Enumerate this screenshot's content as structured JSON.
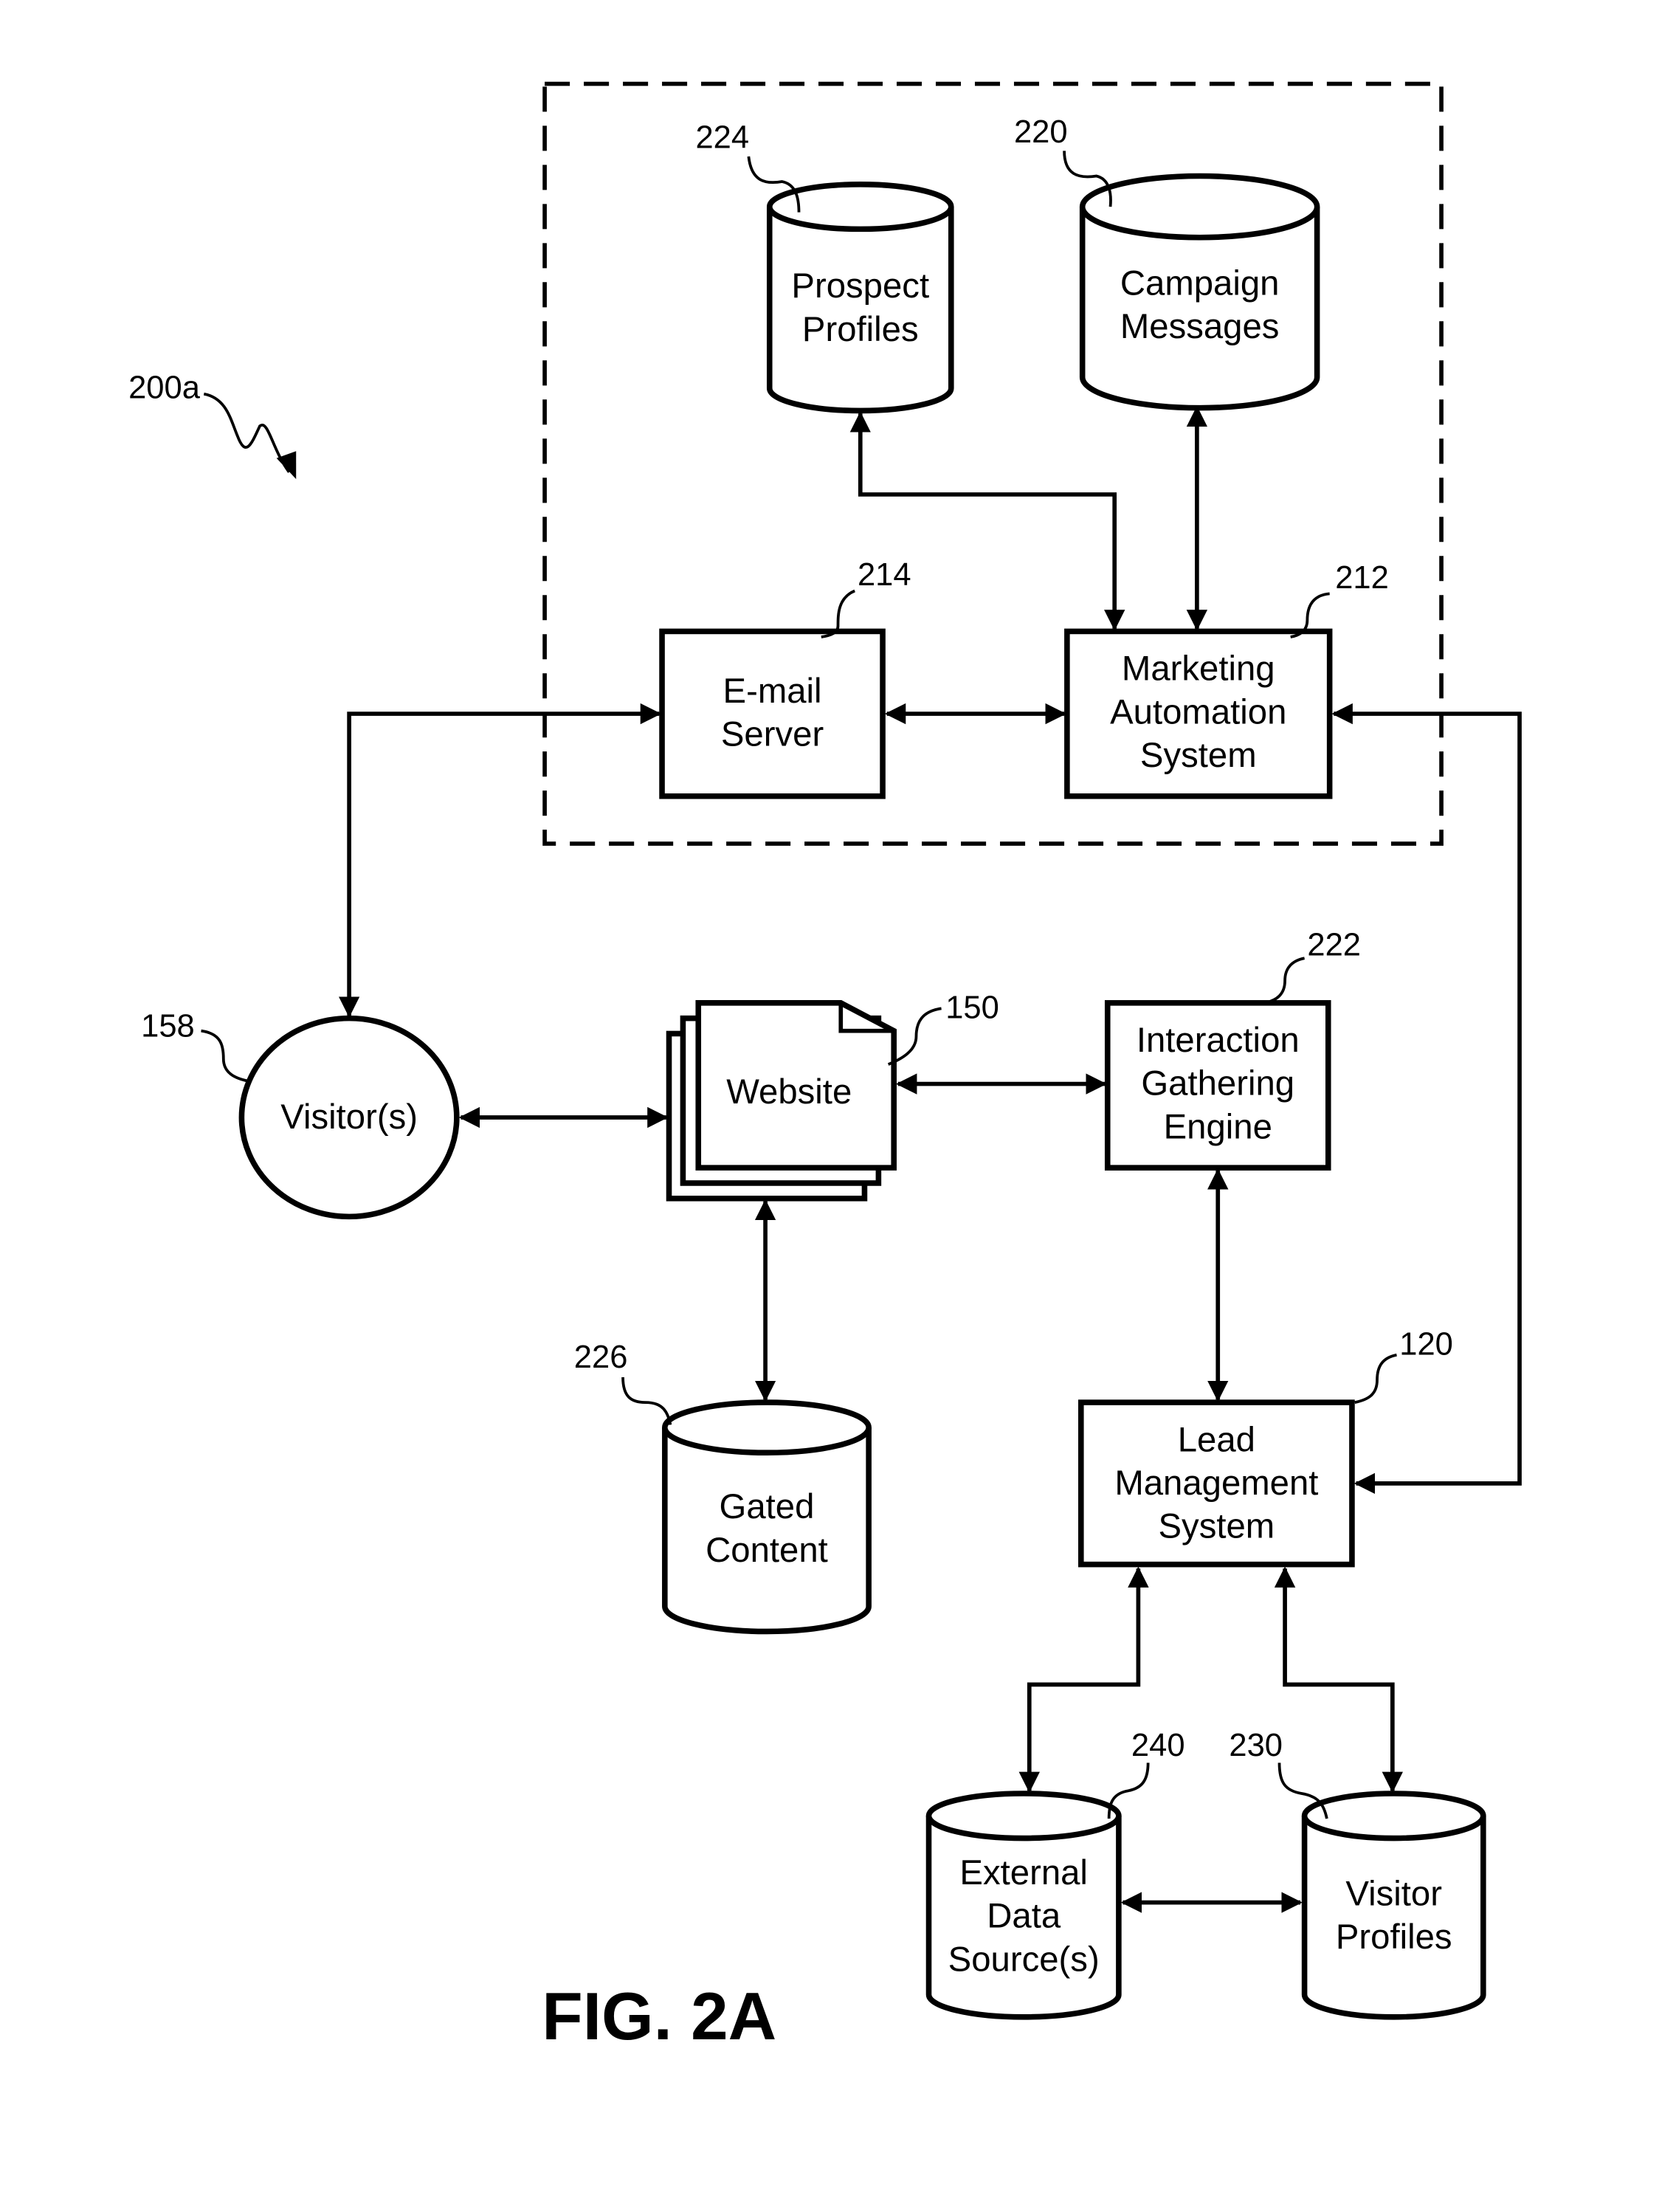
{
  "figure": {
    "title": "FIG. 2A",
    "reference": "200a"
  },
  "nodes": {
    "prospect_profiles": {
      "ref": "224",
      "lines": [
        "Prospect",
        "Profiles"
      ],
      "shape": "database"
    },
    "campaign_messages": {
      "ref": "220",
      "lines": [
        "Campaign",
        "Messages"
      ],
      "shape": "database"
    },
    "email_server": {
      "ref": "214",
      "lines": [
        "E-mail",
        "Server"
      ],
      "shape": "box"
    },
    "marketing_automation": {
      "ref": "212",
      "lines": [
        "Marketing",
        "Automation",
        "System"
      ],
      "shape": "box"
    },
    "visitors": {
      "ref": "158",
      "lines": [
        "Visitor(s)"
      ],
      "shape": "circle"
    },
    "website": {
      "ref": "150",
      "lines": [
        "Website"
      ],
      "shape": "document-stack"
    },
    "interaction_engine": {
      "ref": "222",
      "lines": [
        "Interaction",
        "Gathering",
        "Engine"
      ],
      "shape": "box"
    },
    "gated_content": {
      "ref": "226",
      "lines": [
        "Gated",
        "Content"
      ],
      "shape": "database"
    },
    "lead_management": {
      "ref": "120",
      "lines": [
        "Lead",
        "Management",
        "System"
      ],
      "shape": "box"
    },
    "external_data": {
      "ref": "240",
      "lines": [
        "External",
        "Data",
        "Source(s)"
      ],
      "shape": "database"
    },
    "visitor_profiles": {
      "ref": "230",
      "lines": [
        "Visitor",
        "Profiles"
      ],
      "shape": "database"
    }
  },
  "edges": [
    {
      "from": "marketing_automation",
      "to": "prospect_profiles",
      "direction": "both"
    },
    {
      "from": "marketing_automation",
      "to": "campaign_messages",
      "direction": "both"
    },
    {
      "from": "email_server",
      "to": "marketing_automation",
      "direction": "both"
    },
    {
      "from": "visitors",
      "to": "email_server",
      "direction": "both"
    },
    {
      "from": "lead_management",
      "to": "marketing_automation",
      "direction": "both"
    },
    {
      "from": "visitors",
      "to": "website",
      "direction": "both"
    },
    {
      "from": "website",
      "to": "interaction_engine",
      "direction": "both"
    },
    {
      "from": "website",
      "to": "gated_content",
      "direction": "both"
    },
    {
      "from": "interaction_engine",
      "to": "lead_management",
      "direction": "both"
    },
    {
      "from": "lead_management",
      "to": "external_data",
      "direction": "both"
    },
    {
      "from": "lead_management",
      "to": "visitor_profiles",
      "direction": "both"
    },
    {
      "from": "external_data",
      "to": "visitor_profiles",
      "direction": "both"
    }
  ]
}
